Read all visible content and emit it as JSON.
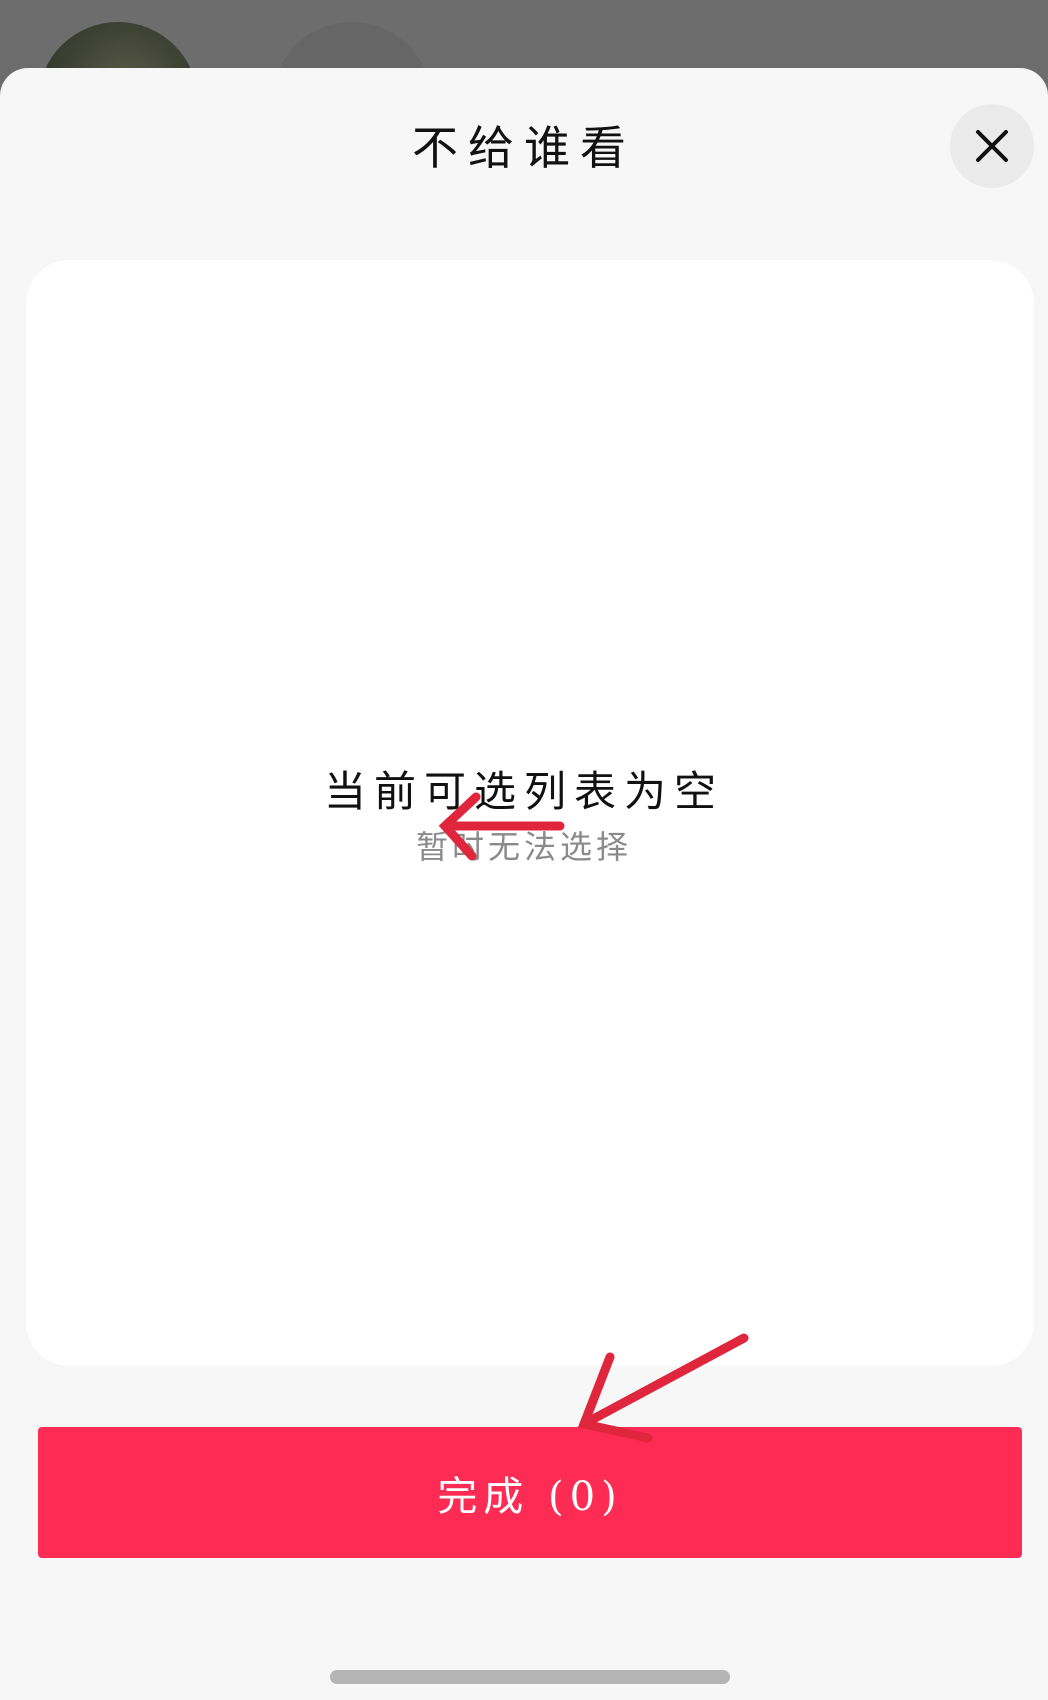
{
  "sheet": {
    "title": "不给谁看",
    "close_icon": "close-icon"
  },
  "list": {
    "empty_title": "当前可选列表为空",
    "empty_subtitle": "暂时无法选择"
  },
  "footer": {
    "done_label": "完成 (0)"
  },
  "colors": {
    "accent": "#fe2c55",
    "annotation_arrow": "#e0263d"
  }
}
